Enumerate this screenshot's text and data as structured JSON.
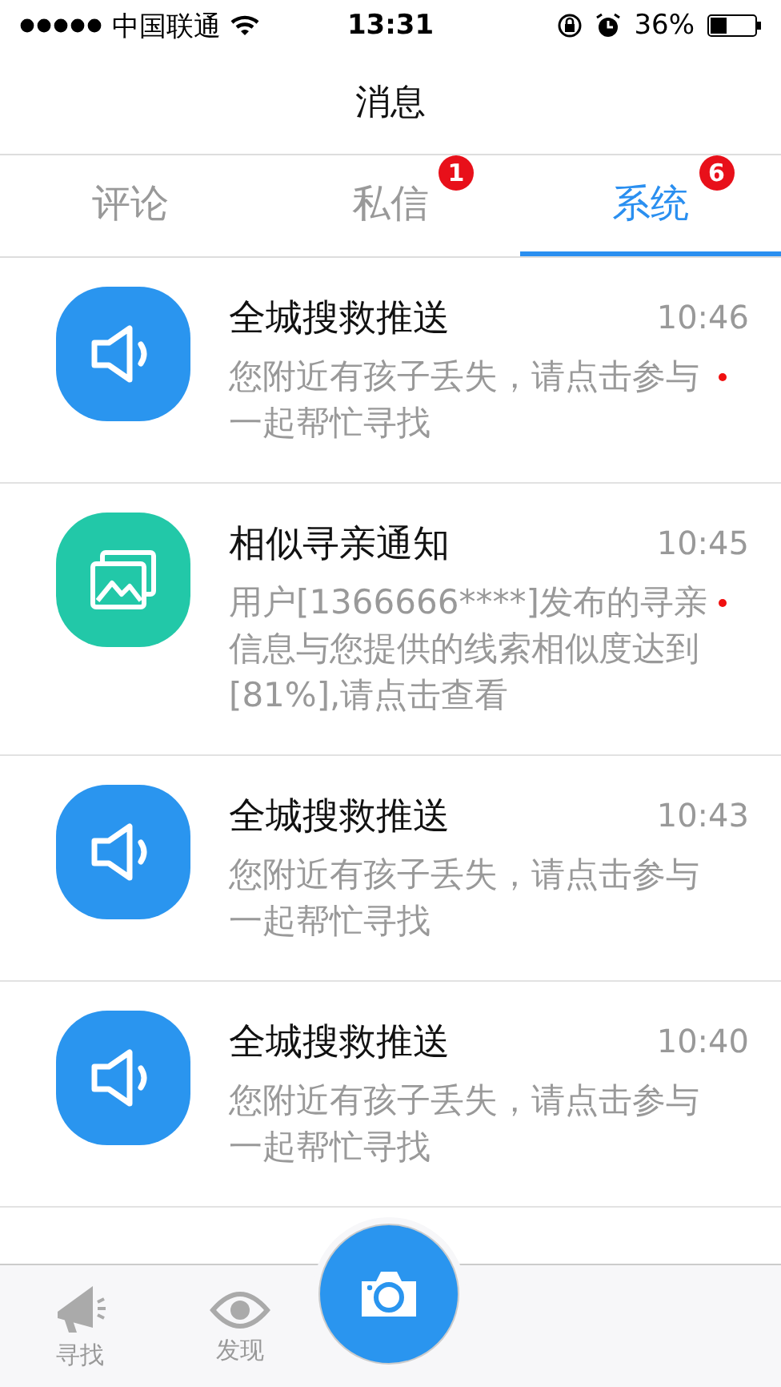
{
  "status_bar": {
    "carrier": "中国联通",
    "time": "13:31",
    "battery": "36%"
  },
  "header": {
    "title": "消息"
  },
  "tabs": [
    {
      "label": "评论",
      "selected": false
    },
    {
      "label": "私信",
      "selected": false,
      "badge": "1"
    },
    {
      "label": "系统",
      "selected": true,
      "badge": "6"
    }
  ],
  "messages": [
    {
      "kind": "speaker",
      "title": "全城搜救推送",
      "time": "10:46",
      "preview": "您附近有孩子丢失，请点击参与一起帮忙寻找",
      "unread": true
    },
    {
      "kind": "gallery",
      "title": "相似寻亲通知",
      "time": "10:45",
      "preview": "用户[1366666****]发布的寻亲信息与您提供的线索相似度达到[81%],请点击查看",
      "unread": true
    },
    {
      "kind": "speaker",
      "title": "全城搜救推送",
      "time": "10:43",
      "preview": "您附近有孩子丢失，请点击参与一起帮忙寻找",
      "unread": false
    },
    {
      "kind": "speaker",
      "title": "全城搜救推送",
      "time": "10:40",
      "preview": "您附近有孩子丢失，请点击参与一起帮忙寻找",
      "unread": false
    }
  ],
  "bottom_nav": [
    {
      "kind": "megaphone",
      "label": "寻找",
      "selected": false
    },
    {
      "kind": "eye",
      "label": "发现",
      "selected": false
    }
  ]
}
